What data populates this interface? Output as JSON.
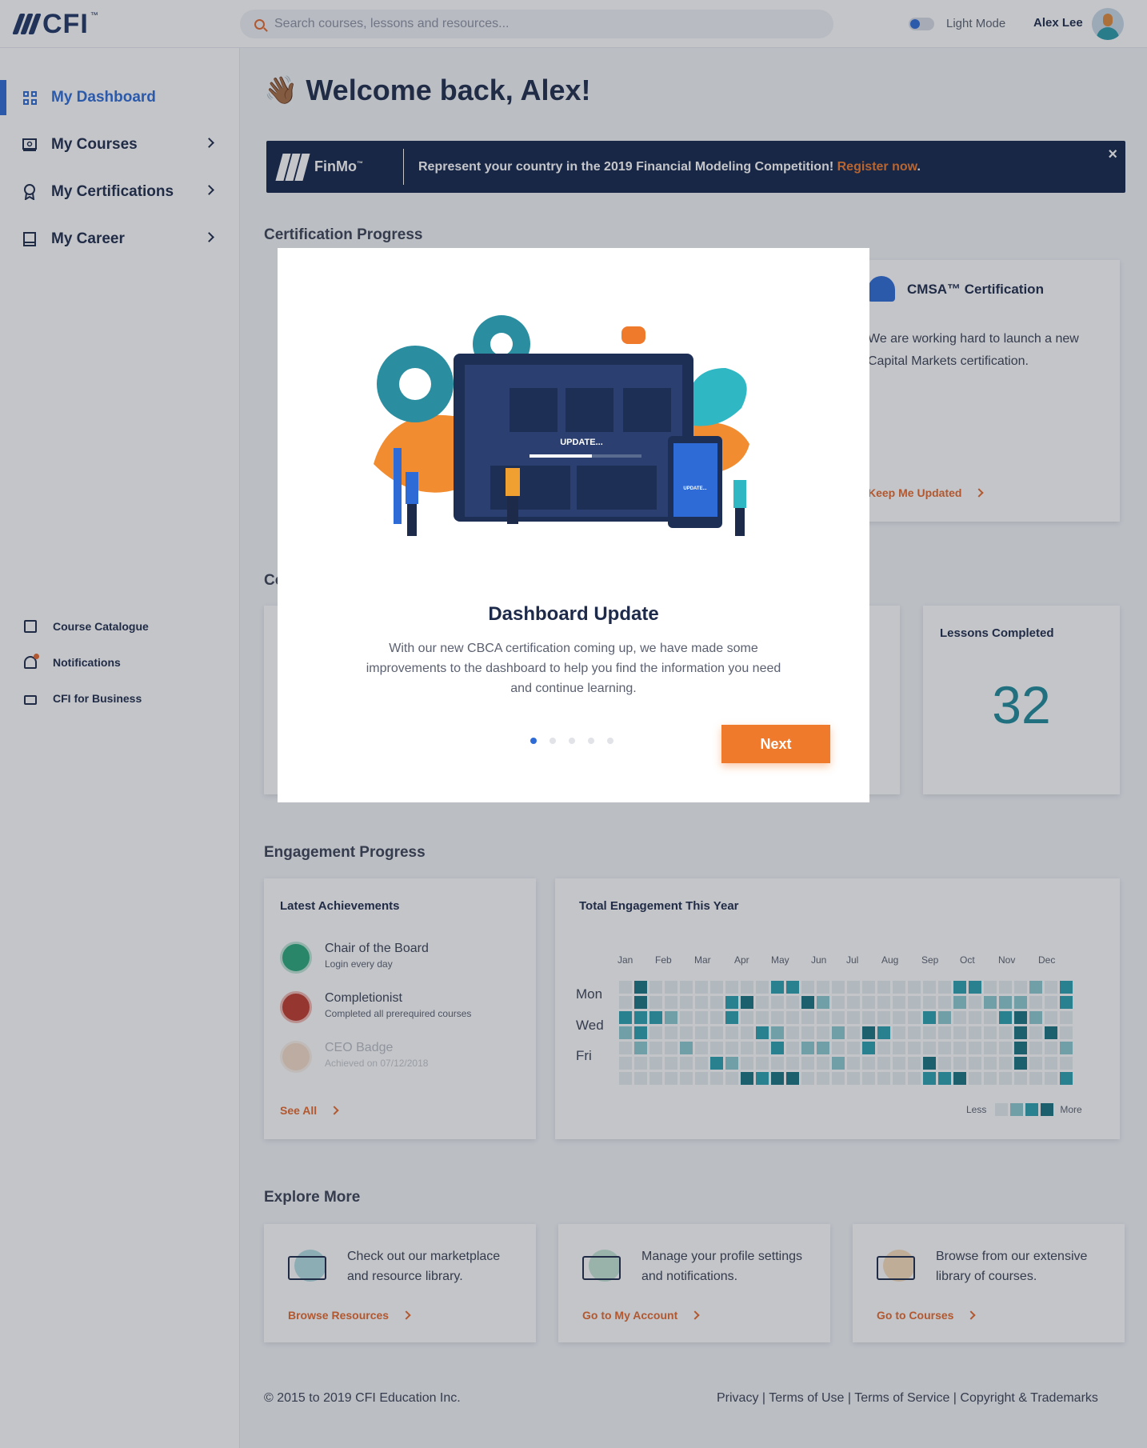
{
  "header": {
    "logo_text": "CFI",
    "logo_tm": "™",
    "search_placeholder": "Search courses, lessons and resources...",
    "mode_label": "Light Mode",
    "user_name": "Alex Lee"
  },
  "sidebar": {
    "items": [
      {
        "label": "My Dashboard",
        "active": true,
        "icon": "dashboard-grid-icon"
      },
      {
        "label": "My Courses",
        "icon": "courses-icon"
      },
      {
        "label": "My Certifications",
        "icon": "certificate-icon"
      },
      {
        "label": "My Career",
        "icon": "book-icon"
      }
    ],
    "secondary": [
      {
        "label": "Course Catalogue",
        "icon": "catalogue-icon"
      },
      {
        "label": "Notifications",
        "icon": "bell-icon"
      },
      {
        "label": "CFI for Business",
        "icon": "briefcase-icon"
      }
    ]
  },
  "main": {
    "welcome": "Welcome back, Alex!",
    "wave": "👋🏾",
    "banner": {
      "brand": "FinMo",
      "brand_tm": "™",
      "message": "Represent your country in the 2019 Financial Modeling Competition! ",
      "link": "Register now",
      "suffix": ".",
      "close": "×"
    },
    "certification_title": "Certification Progress",
    "cmsa": {
      "title": "CMSA™ Certification",
      "desc": "We are working hard to launch a new Capital Markets certification.",
      "link": "Keep Me Updated"
    },
    "partial_heading": "Co",
    "lessons": {
      "title": "Lessons Completed",
      "value": "32"
    },
    "engagement_title": "Engagement Progress",
    "achievements": {
      "title": "Latest Achievements",
      "items": [
        {
          "name": "Chair of the Board",
          "desc": "Login every day"
        },
        {
          "name": "Completionist",
          "desc": "Completed all prerequired courses"
        },
        {
          "name": "CEO Badge",
          "desc": "Achieved  on 07/12/2018"
        }
      ],
      "see_all": "See All"
    },
    "engagement": {
      "title": "Total Engagement This Year",
      "months": [
        "Jan",
        "Feb",
        "Mar",
        "Apr",
        "May",
        "Jun",
        "Jul",
        "Aug",
        "Sep",
        "Oct",
        "Nov",
        "Dec"
      ],
      "days": [
        "Mon",
        "Wed",
        "Fri"
      ],
      "legend_less": "Less",
      "legend_more": "More",
      "colors": [
        "#e6eef0",
        "#8ccbd2",
        "#2aa0ad",
        "#1a7480"
      ]
    },
    "explore_title": "Explore More",
    "explore": [
      {
        "text": "Check out our marketplace and resource library.",
        "link": "Browse Resources",
        "accent": "#2aa0ad"
      },
      {
        "text": "Manage your profile settings and notifications.",
        "link": "Go to My Account",
        "accent": "#58b88a"
      },
      {
        "text": "Browse from our extensive library of courses.",
        "link": "Go to Courses",
        "accent": "#f0a040"
      }
    ],
    "footer": {
      "copyright": "© 2015 to 2019 CFI Education Inc.",
      "links": "Privacy | Terms of Use | Terms of Service | Copyright & Trademarks"
    }
  },
  "modal": {
    "title": "Dashboard Update",
    "body": "With our new CBCA certification coming up, we have made some improvements to the dashboard to help you find the information you need and continue learning.",
    "next_label": "Next",
    "illustration_text": "UPDATE...",
    "phone_text": "UPDATE...",
    "page_count": 5,
    "active_page": 1
  }
}
